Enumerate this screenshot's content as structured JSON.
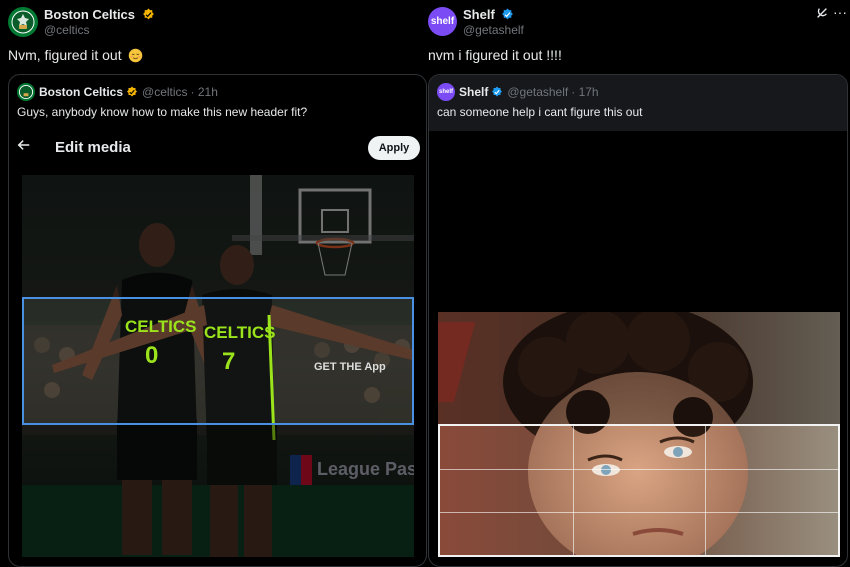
{
  "left_post": {
    "author_name": "Boston Celtics",
    "author_handle": "@celtics",
    "text": "Nvm, figured it out",
    "quoted": {
      "author_name": "Boston Celtics",
      "author_handle": "@celtics",
      "time": "· 21h",
      "text": "Guys, anybody know how to make this new header fit?",
      "editor": {
        "back_icon": "arrow-left-icon",
        "title": "Edit media",
        "apply_label": "Apply"
      },
      "photo_texts": {
        "jersey_1_name": "CELTICS",
        "jersey_1_number": "0",
        "jersey_2_name": "CELTICS",
        "jersey_2_number": "7",
        "get_the_app": "GET THE App",
        "league_pass": "League Pass"
      }
    }
  },
  "right_post": {
    "author_name": "Shelf",
    "author_handle": "@getashelf",
    "avatar_text": "shelf",
    "text": "nvm i figured it out !!!!",
    "quoted": {
      "author_name": "Shelf",
      "author_handle": "@getashelf",
      "time": "· 17h",
      "text": "can someone help i cant figure this out",
      "avatar_text": "shelf"
    }
  },
  "icons": {
    "verified": "verified-badge-icon",
    "grok": "grok-icon",
    "more": "more-options-icon"
  },
  "colors": {
    "background": "#000000",
    "celtics_green": "#007a33",
    "verified_gold": "#f4b400",
    "verified_blue": "#1d9bf0",
    "shelf_purple": "#7b4cf5",
    "crop_blue": "#4a90e2",
    "neon_green": "#9be31b"
  }
}
